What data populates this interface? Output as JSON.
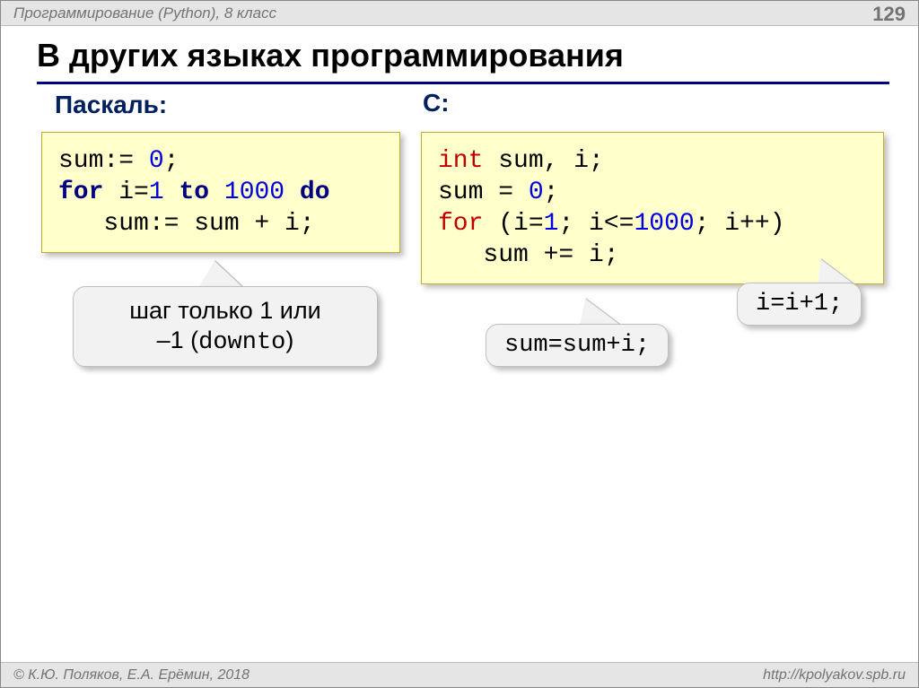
{
  "header": {
    "topic": "Программирование (Python), 8 класс",
    "page_number": "129"
  },
  "title": "В других языках программирования",
  "left": {
    "lang_label": "Паскаль:",
    "code": {
      "l1a": "sum:= ",
      "l1num": "0",
      "l1b": ";",
      "l2a": "for",
      "l2b": " i=",
      "l2num1": "1",
      "l2c": " ",
      "l2to": "to",
      "l2d": " ",
      "l2num2": "1000",
      "l2e": " ",
      "l2do": "do",
      "l3a": "   sum:= sum + i;"
    },
    "callout_line1": "шаг только 1 или",
    "callout_line2a": "–1 (",
    "callout_line2b": "downto",
    "callout_line2c": ")"
  },
  "right": {
    "lang_label": "С:",
    "code": {
      "l1int": "int",
      "l1rest": " sum, i;",
      "l2a": "sum = ",
      "l2num": "0",
      "l2b": ";",
      "l3for": "for",
      "l3a": " (i=",
      "l3n1": "1",
      "l3b": "; i<=",
      "l3n2": "1000",
      "l3c": "; i++)",
      "l4": "   sum += i;"
    },
    "callout_sum": "sum=sum+i;",
    "callout_i": "i=i+1;"
  },
  "footer": {
    "copyright": "© К.Ю. Поляков, Е.А. Ерёмин, 2018",
    "url": "http://kpolyakov.spb.ru"
  }
}
